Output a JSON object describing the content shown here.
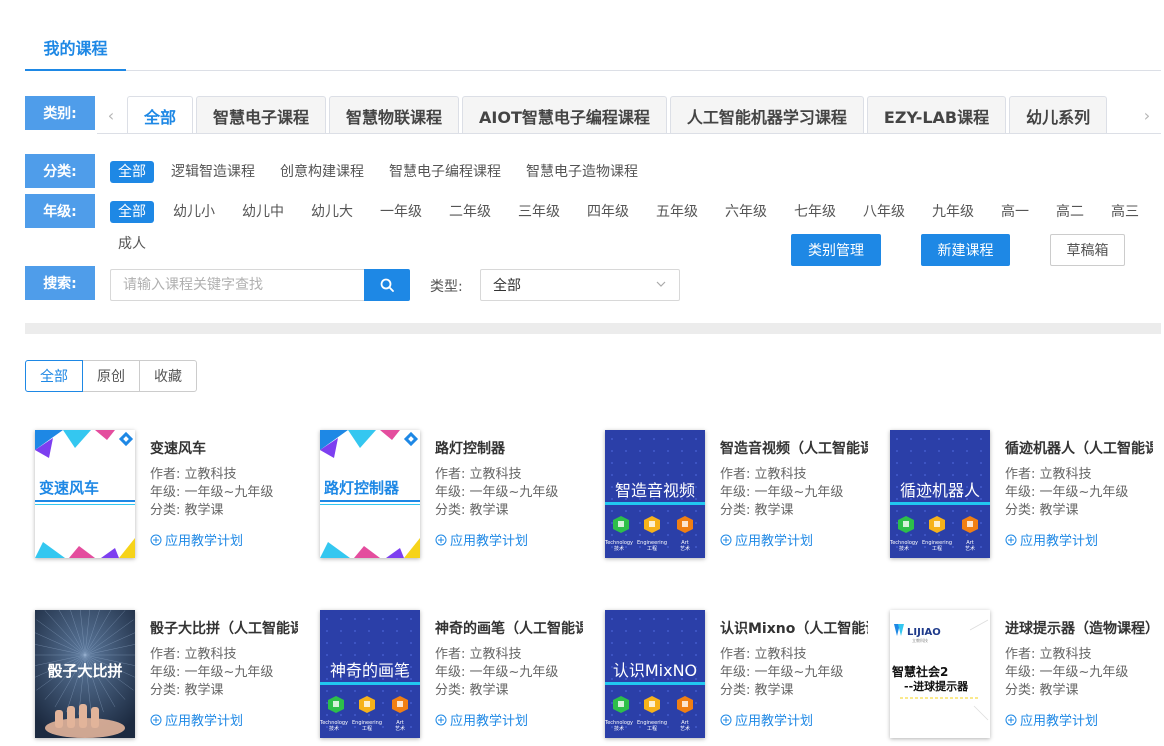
{
  "page_tab": "我的课程",
  "filters": {
    "category_label": "类别:",
    "type_label": "分类:",
    "grade_label": "年级:",
    "search_label": "搜索:"
  },
  "categories": [
    "全部",
    "智慧电子课程",
    "智慧物联课程",
    "AIOT智慧电子编程课程",
    "人工智能机器学习课程",
    "EZY-LAB课程",
    "幼儿系列"
  ],
  "types": [
    "全部",
    "逻辑智造课程",
    "创意构建课程",
    "智慧电子编程课程",
    "智慧电子造物课程"
  ],
  "grades": [
    "全部",
    "幼儿小",
    "幼儿中",
    "幼儿大",
    "一年级",
    "二年级",
    "三年级",
    "四年级",
    "五年级",
    "六年级",
    "七年级",
    "八年级",
    "九年级",
    "高一",
    "高二",
    "高三"
  ],
  "grades_row2": [
    "成人"
  ],
  "actions": {
    "manage": "类别管理",
    "new_course": "新建课程",
    "drafts": "草稿箱"
  },
  "search": {
    "placeholder": "请输入课程关键字查找",
    "type_label": "类型:",
    "type_value": "全部"
  },
  "segments": [
    "全部",
    "原创",
    "收藏"
  ],
  "courses": [
    {
      "title": "变速风车",
      "author": "作者: 立教科技",
      "grade": "年级: 一年级~九年级",
      "category": "分类: 教学课",
      "link": "应用教学计划",
      "thumb_text": "变速风车",
      "thumb_style": "white"
    },
    {
      "title": "路灯控制器",
      "author": "作者: 立教科技",
      "grade": "年级: 一年级~九年级",
      "category": "分类: 教学课",
      "link": "应用教学计划",
      "thumb_text": "路灯控制器",
      "thumb_style": "white"
    },
    {
      "title": "智造音视频（人工智能课程）",
      "author": "作者: 立教科技",
      "grade": "年级: 一年级~九年级",
      "category": "分类: 教学课",
      "link": "应用教学计划",
      "thumb_text": "智造音视频",
      "thumb_style": "blue"
    },
    {
      "title": "循迹机器人（人工智能课程）",
      "author": "作者: 立教科技",
      "grade": "年级: 一年级~九年级",
      "category": "分类: 教学课",
      "link": "应用教学计划",
      "thumb_text": "循迹机器人",
      "thumb_style": "blue"
    },
    {
      "title": "骰子大比拼（人工智能课程）",
      "author": "作者: 立教科技",
      "grade": "年级: 一年级~九年级",
      "category": "分类: 教学课",
      "link": "应用教学计划",
      "thumb_text": "骰子大比拼",
      "thumb_style": "photo"
    },
    {
      "title": "神奇的画笔（人工智能课程）",
      "author": "作者: 立教科技",
      "grade": "年级: 一年级~九年级",
      "category": "分类: 教学课",
      "link": "应用教学计划",
      "thumb_text": "神奇的画笔",
      "thumb_style": "blue"
    },
    {
      "title": "认识Mixno（人工智能课程）",
      "author": "作者: 立教科技",
      "grade": "年级: 一年级~九年级",
      "category": "分类: 教学课",
      "link": "应用教学计划",
      "thumb_text": "认识MixNO",
      "thumb_style": "blue"
    },
    {
      "title": "进球提示器（造物课程）",
      "author": "作者: 立教科技",
      "grade": "年级: 一年级~九年级",
      "category": "分类: 教学课",
      "link": "应用教学计划",
      "thumb_text": "智慧社会2",
      "thumb_text2": "--进球提示器",
      "thumb_brand": "LIJIAO",
      "thumb_brand_sub": "立教科技",
      "thumb_style": "lijiao"
    }
  ],
  "thumb_badges": {
    "t1": "Technology",
    "t1_cn": "技术",
    "t2": "Engineering",
    "t2_cn": "工程",
    "t3": "Art",
    "t3_cn": "艺术"
  },
  "colors": {
    "primary": "#1e88e5",
    "label_bg": "#4f9dea",
    "thumb_blue": "#2b3fa8"
  }
}
